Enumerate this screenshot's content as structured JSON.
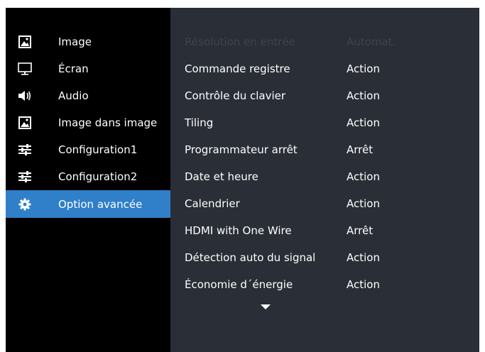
{
  "sidebar": {
    "items": [
      {
        "label": "Image",
        "icon": "picture-icon"
      },
      {
        "label": "Écran",
        "icon": "monitor-icon"
      },
      {
        "label": "Audio",
        "icon": "speaker-icon"
      },
      {
        "label": "Image dans image",
        "icon": "picture-icon"
      },
      {
        "label": "Configuration1",
        "icon": "sliders-icon"
      },
      {
        "label": "Configuration2",
        "icon": "sliders-icon"
      },
      {
        "label": "Option avancée",
        "icon": "gear-icon",
        "selected": true
      }
    ]
  },
  "panel": {
    "rows": [
      {
        "label": "Résolution en entrée",
        "value": "Automat.",
        "disabled": true
      },
      {
        "label": "Commande registre",
        "value": "Action"
      },
      {
        "label": "Contrôle du clavier",
        "value": "Action"
      },
      {
        "label": "Tiling",
        "value": "Action"
      },
      {
        "label": "Programmateur arrêt",
        "value": "Arrêt"
      },
      {
        "label": "Date et heure",
        "value": "Action"
      },
      {
        "label": "Calendrier",
        "value": "Action"
      },
      {
        "label": "HDMI with One Wire",
        "value": "Arrêt"
      },
      {
        "label": "Détection auto du signal",
        "value": "Action"
      },
      {
        "label": "Économie d´énergie",
        "value": "Action"
      }
    ],
    "scroll_icon": "chevron-down-icon"
  },
  "colors": {
    "accent": "#2f7fc9",
    "panel_bg": "#2a2e36",
    "sidebar_bg": "#000000",
    "disabled_text": "#3e434c"
  }
}
